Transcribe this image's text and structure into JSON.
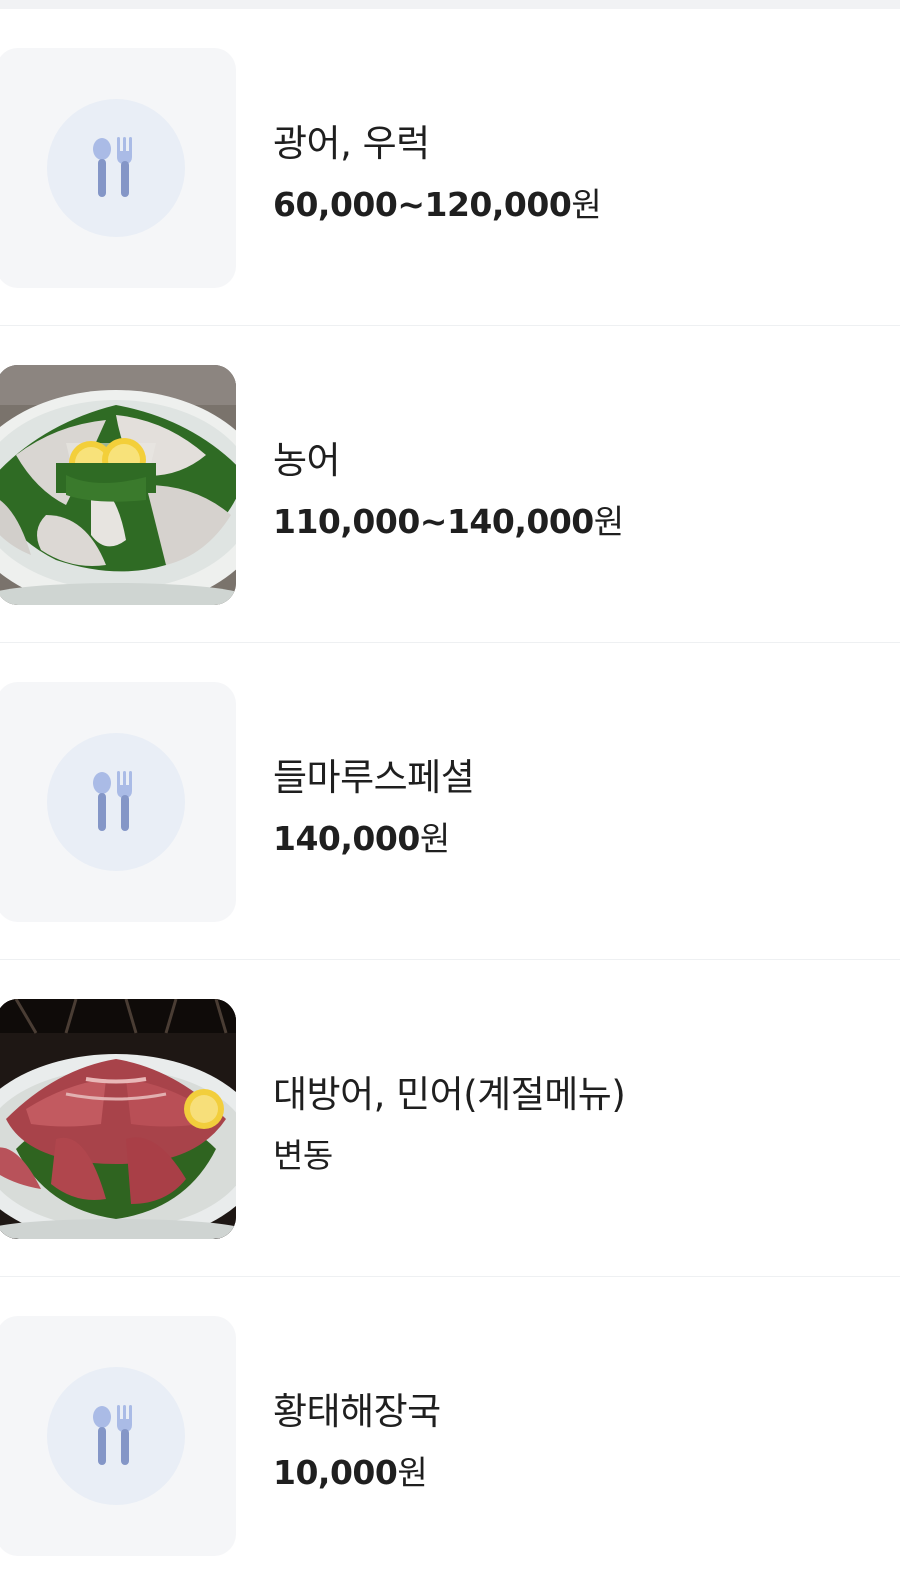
{
  "menu": {
    "items": [
      {
        "name": "광어, 우럭",
        "price_amount": "60,000~120,000",
        "price_unit": "원",
        "image": "placeholder"
      },
      {
        "name": "농어",
        "price_amount": "110,000~140,000",
        "price_unit": "원",
        "image": "sea-bass-sashimi-photo"
      },
      {
        "name": "들마루스페셜",
        "price_amount": "140,000",
        "price_unit": "원",
        "image": "placeholder"
      },
      {
        "name": "대방어, 민어(계절메뉴)",
        "price_text": "변동",
        "image": "yellowtail-sashimi-photo"
      },
      {
        "name": "황태해장국",
        "price_amount": "10,000",
        "price_unit": "원",
        "image": "placeholder"
      }
    ]
  },
  "icons": {
    "placeholder": "fork-spoon-icon"
  },
  "colors": {
    "text": "#1f1f1f",
    "placeholder_bg": "#f5f6f8",
    "placeholder_circle": "#e9eef6",
    "icon": "#8496c7",
    "divider": "#eef0f2"
  }
}
